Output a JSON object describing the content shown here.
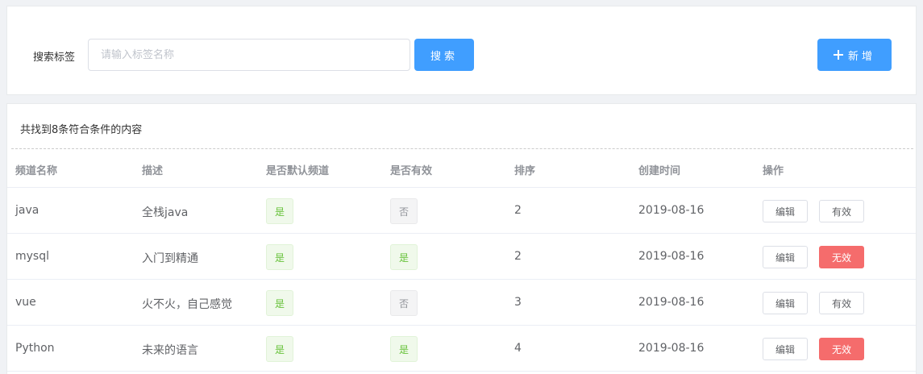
{
  "search": {
    "label": "搜索标签",
    "placeholder": "请输入标签名称",
    "value": "",
    "search_button": "搜索",
    "add_button": "新增"
  },
  "table": {
    "result_count": "共找到8条符合条件的内容",
    "headers": [
      "频道名称",
      "描述",
      "是否默认频道",
      "是否有效",
      "排序",
      "创建时间",
      "操作"
    ],
    "edit_label": "编辑",
    "rows": [
      {
        "name": "java",
        "description": "全栈java",
        "is_default": "是",
        "is_valid": "否",
        "sort": "2",
        "created": "2019-08-16",
        "action": "有效"
      },
      {
        "name": "mysql",
        "description": "入门到精通",
        "is_default": "是",
        "is_valid": "是",
        "sort": "2",
        "created": "2019-08-16",
        "action": "无效"
      },
      {
        "name": "vue",
        "description": "火不火，自己感觉",
        "is_default": "是",
        "is_valid": "否",
        "sort": "3",
        "created": "2019-08-16",
        "action": "有效"
      },
      {
        "name": "Python",
        "description": "未来的语言",
        "is_default": "是",
        "is_valid": "是",
        "sort": "4",
        "created": "2019-08-16",
        "action": "无效"
      }
    ]
  },
  "colors": {
    "primary": "#409eff",
    "danger": "#f56c6c",
    "success": "#67c23a"
  }
}
